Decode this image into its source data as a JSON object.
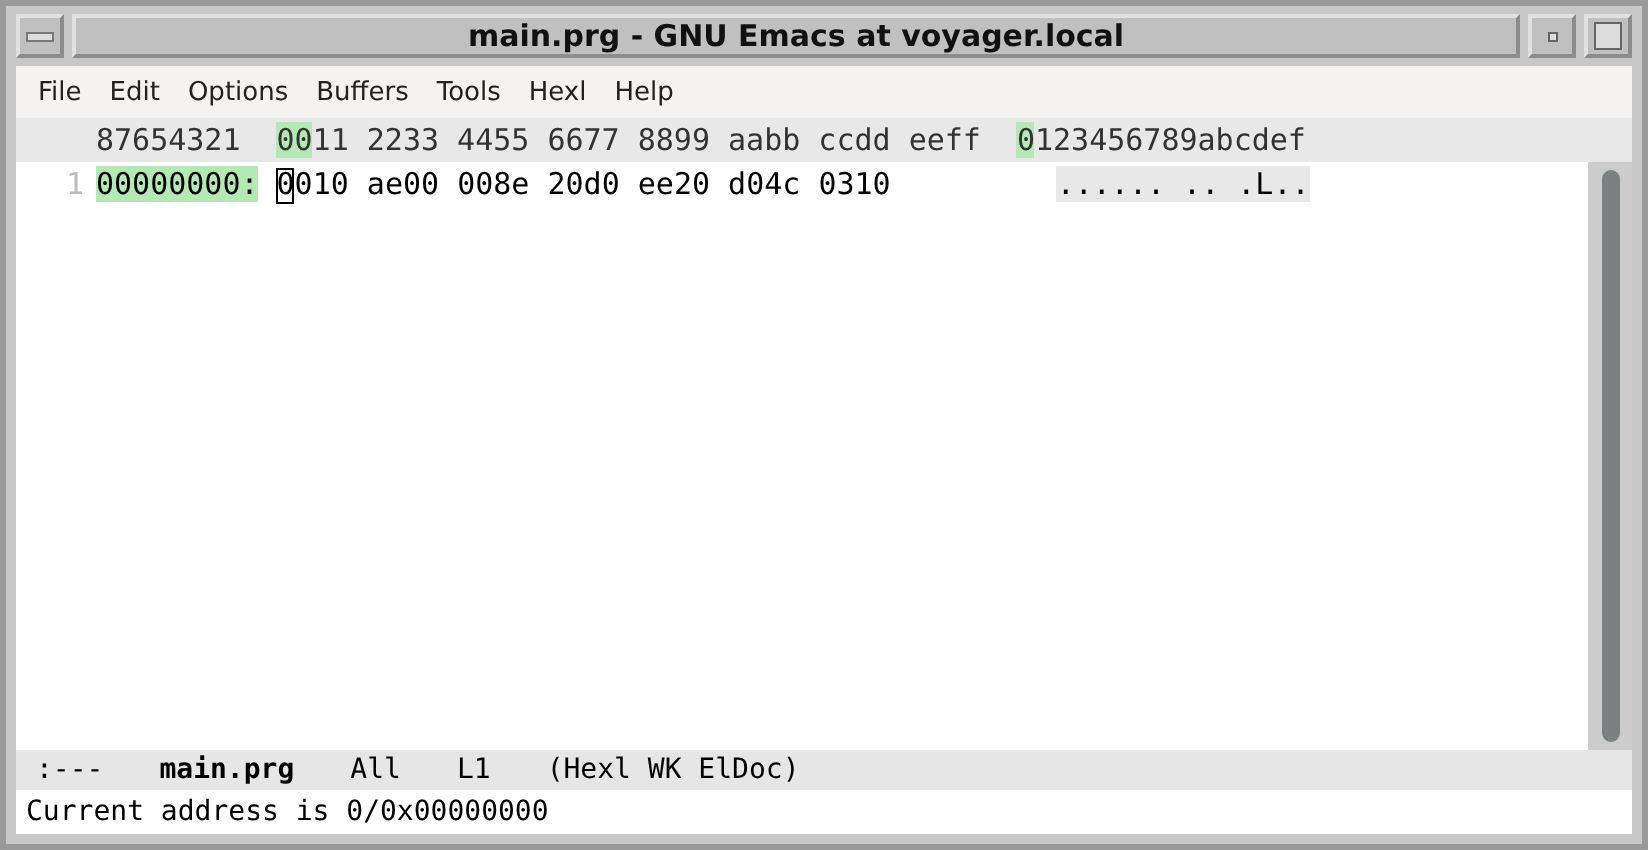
{
  "window": {
    "title": "main.prg - GNU Emacs at voyager.local"
  },
  "menu": [
    "File",
    "Edit",
    "Options",
    "Buffers",
    "Tools",
    "Hexl",
    "Help"
  ],
  "header_line": {
    "address": "87654321",
    "hex": "0011 2233 4455 6677 8899 aabb ccdd eeff",
    "ascii": "0123456789abcdef"
  },
  "rows": [
    {
      "line_number": "1",
      "address": "00000000:",
      "hex": "0010 ae00 008e 20d0 ee20 d04c 0310",
      "ascii": "...... .. .L.."
    }
  ],
  "mode_line": {
    "status": ":---",
    "buffer": "main.prg",
    "position": "All",
    "line": "L1",
    "modes": "(Hexl WK ElDoc)"
  },
  "minibuffer": "Current address is 0/0x00000000"
}
